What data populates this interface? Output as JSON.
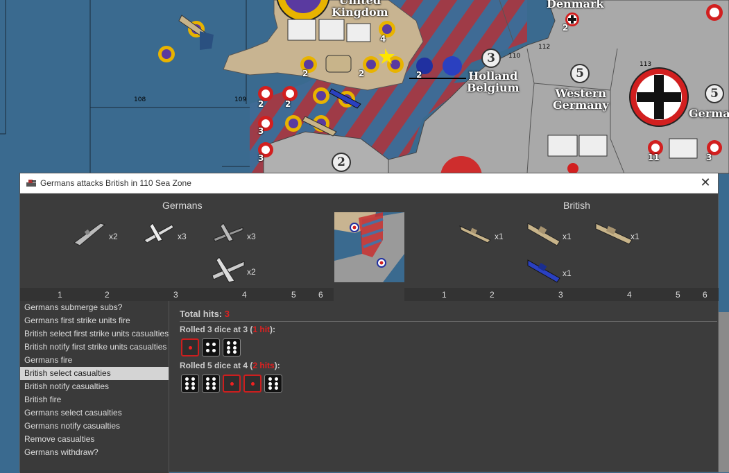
{
  "map": {
    "territories": [
      {
        "name_line1": "United",
        "name_line2": "Kingdom",
        "pu": ""
      },
      {
        "name_line1": "Holland",
        "name_line2": "Belgium",
        "pu": "3"
      },
      {
        "name_line1": "Western",
        "name_line2": "Germany",
        "pu": "5"
      },
      {
        "name_line1": "Denmark",
        "name_line2": "",
        "pu": ""
      },
      {
        "name_line1": "German",
        "name_line2": "",
        "pu": "5"
      }
    ],
    "zone_numbers": [
      "108",
      "109",
      "110",
      "112",
      "113"
    ],
    "pu_values": [
      "3",
      "5",
      "5",
      "2"
    ],
    "unit_counts": [
      "2",
      "4",
      "2",
      "2",
      "2",
      "2",
      "2",
      "2",
      "3",
      "3",
      "11",
      "3",
      "2"
    ]
  },
  "dialog": {
    "title": "Germans attacks British in 110 Sea Zone",
    "attacker": {
      "name": "Germans",
      "units": [
        {
          "icon": "submarine-icon",
          "qty": "x2"
        },
        {
          "icon": "fighter-icon",
          "qty": "x3"
        },
        {
          "icon": "tactical-bomber-icon",
          "qty": "x3"
        },
        {
          "icon": "bomber-icon",
          "qty": "x2"
        }
      ]
    },
    "defender": {
      "name": "British",
      "units": [
        {
          "icon": "destroyer-icon",
          "qty": "x1"
        },
        {
          "icon": "cruiser-icon",
          "qty": "x1"
        },
        {
          "icon": "battleship-icon",
          "qty": "x1"
        },
        {
          "icon": "french-cruiser-icon",
          "qty": "x1"
        }
      ]
    },
    "attacker_dice_columns": [
      "1",
      "2",
      "3",
      "4",
      "5",
      "6"
    ],
    "defender_dice_columns": [
      "1",
      "2",
      "3",
      "4",
      "5",
      "6"
    ],
    "steps": [
      "Germans submerge subs?",
      "Germans first strike units fire",
      "British select first strike units casualties",
      "British notify first strike units casualties",
      "Germans fire",
      "British select casualties",
      "British notify casualties",
      "British fire",
      "Germans select casualties",
      "Germans notify casualties",
      "Remove casualties",
      "Germans withdraw?"
    ],
    "selected_step": 5,
    "results": {
      "total_label": "Total hits:",
      "total_value": "3",
      "rolls": [
        {
          "prefix": "Rolled 3 dice at 3 (",
          "hits": "1 hit",
          "suffix": "):",
          "dice": [
            {
              "value": 1,
              "hit": true
            },
            {
              "value": 4,
              "hit": false
            },
            {
              "value": 6,
              "hit": false
            }
          ]
        },
        {
          "prefix": "Rolled 5 dice at 4 (",
          "hits": "2 hits",
          "suffix": "):",
          "dice": [
            {
              "value": 6,
              "hit": false
            },
            {
              "value": 6,
              "hit": false
            },
            {
              "value": 1,
              "hit": true
            },
            {
              "value": 1,
              "hit": true
            },
            {
              "value": 6,
              "hit": false
            }
          ]
        }
      ]
    }
  },
  "colors": {
    "sea": "#3a6a8f",
    "uk_land": "#c8b491",
    "german_land": "#a9a9a9",
    "hit_red": "#e02020",
    "dialog_bg": "#3c3c3c",
    "selected_step_bg": "#d4d4d4"
  }
}
